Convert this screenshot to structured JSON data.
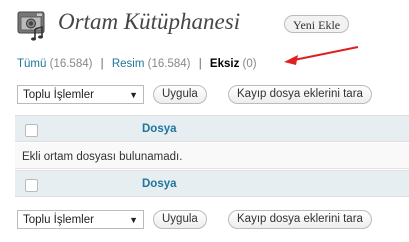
{
  "header": {
    "title": "Ortam Kütüphanesi",
    "add_new_label": "Yeni Ekle",
    "icon": "media-library-icon"
  },
  "filters": {
    "items": [
      {
        "label": "Tümü",
        "count": "(16.584)",
        "current": false
      },
      {
        "label": "Resim",
        "count": "(16.584)",
        "current": false
      },
      {
        "label": "Eksiz",
        "count": "(0)",
        "current": true
      }
    ],
    "separator": "|"
  },
  "annotation": {
    "arrow_color": "#e02020",
    "icon": "red-arrow-icon"
  },
  "bulk_actions": {
    "selected": "Toplu İşlemler",
    "apply_label": "Uygula",
    "find_lost_label": "Kayıp dosya eklerini tara"
  },
  "table": {
    "column_title": "Dosya",
    "empty_message": "Ekli ortam dosyası bulunamadı."
  },
  "colors": {
    "link": "#21759b",
    "header_bg": "#e7eef2"
  }
}
